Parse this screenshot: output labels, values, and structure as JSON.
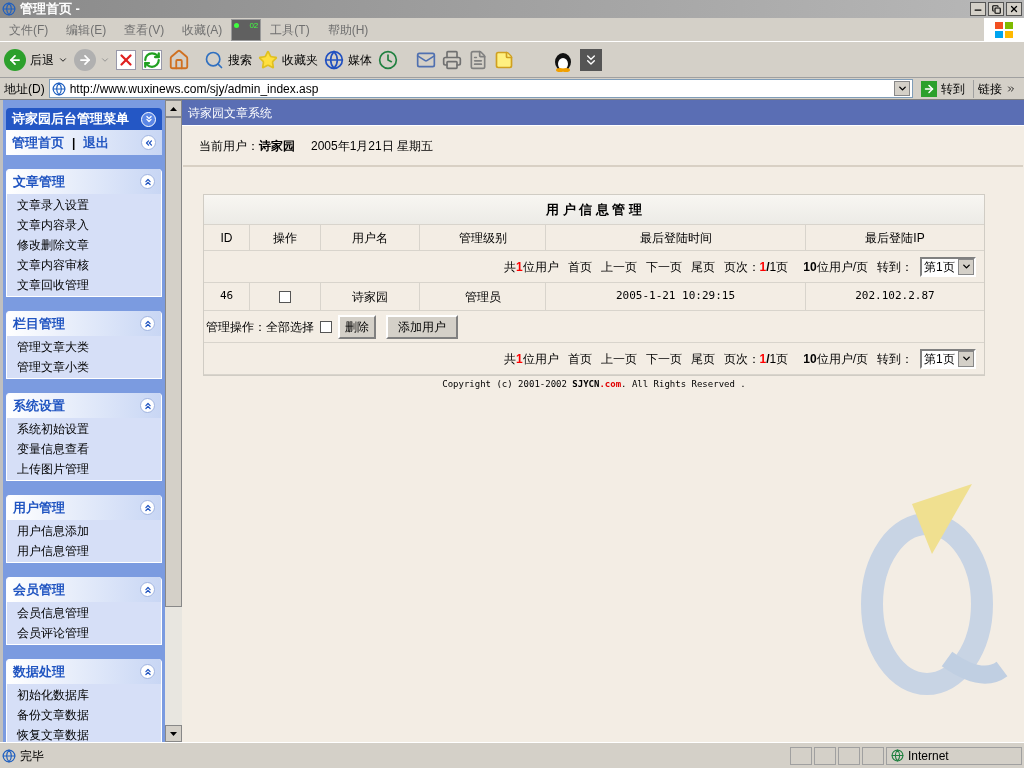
{
  "window": {
    "title": "管理首页 -"
  },
  "menu": [
    "文件(F)",
    "编辑(E)",
    "查看(V)",
    "收藏(A)",
    "工具(T)",
    "帮助(H)"
  ],
  "overlay_counter": "02",
  "toolbar": {
    "back": "后退",
    "search": "搜索",
    "favorites": "收藏夹",
    "media": "媒体"
  },
  "address": {
    "label": "地址(D)",
    "value": "http://www.wuxinews.com/sjy/admin_index.asp",
    "go": "转到",
    "links": "链接"
  },
  "sidebar": {
    "title": "诗家园后台管理菜单",
    "home": "管理首页",
    "separator": "|",
    "logout": "退出",
    "sections": [
      {
        "title": "文章管理",
        "expanded": true,
        "items": [
          "文章录入设置",
          "文章内容录入",
          "修改删除文章",
          "文章内容审核",
          "文章回收管理"
        ]
      },
      {
        "title": "栏目管理",
        "expanded": true,
        "items": [
          "管理文章大类",
          "管理文章小类"
        ]
      },
      {
        "title": "系统设置",
        "expanded": true,
        "items": [
          "系统初始设置",
          "变量信息查看",
          "上传图片管理"
        ]
      },
      {
        "title": "用户管理",
        "expanded": true,
        "items": [
          "用户信息添加",
          "用户信息管理"
        ]
      },
      {
        "title": "会员管理",
        "expanded": true,
        "items": [
          "会员信息管理",
          "会员评论管理"
        ]
      },
      {
        "title": "数据处理",
        "expanded": true,
        "items": [
          "初始化数据库",
          "备份文章数据",
          "恢复文章数据"
        ]
      }
    ]
  },
  "header": {
    "title": "诗家园文章系统",
    "user_label": "当前用户：",
    "user": "诗家园",
    "date": "2005年1月21日 星期五"
  },
  "table": {
    "title": "用 户 信 息 管 理",
    "columns": [
      "ID",
      "操作",
      "用户名",
      "管理级别",
      "最后登陆时间",
      "最后登陆IP"
    ],
    "rows": [
      {
        "id": "46",
        "checked": false,
        "name": "诗家园",
        "level_name": "管理员",
        "time": "2005-1-21 10:29:15",
        "ip": "202.102.2.87"
      }
    ],
    "pagers": [
      {
        "prefix": "共",
        "total": "1",
        "suffix": "位用户",
        "links": [
          "首页",
          "上一页",
          "下一页",
          "尾页"
        ],
        "page_label": "页次：",
        "page_current": "1",
        "page_total": "/1页",
        "per_page": "10",
        "per_page_suffix": "位用户/页",
        "goto_label": "转到：",
        "select": "第1页"
      },
      {
        "prefix": "共",
        "total": "1",
        "suffix": "位用户",
        "links": [
          "首页",
          "上一页",
          "下一页",
          "尾页"
        ],
        "page_label": "页次：",
        "page_current": "1",
        "page_total": "/1页",
        "per_page": "10",
        "per_page_suffix": "位用户/页",
        "goto_label": "转到：",
        "select": "第1页"
      }
    ],
    "actions": {
      "label": "管理操作：全部选择",
      "select_all": false,
      "delete": "删除",
      "add": "添加用户"
    }
  },
  "copyright": {
    "text": "Copyright (c) 2001-2002 ",
    "brand": "SJYCN",
    "domain": ".com",
    "tail": ". All Rights Reserved ."
  },
  "status_bar": {
    "text": "完毕",
    "zone": "Internet"
  }
}
